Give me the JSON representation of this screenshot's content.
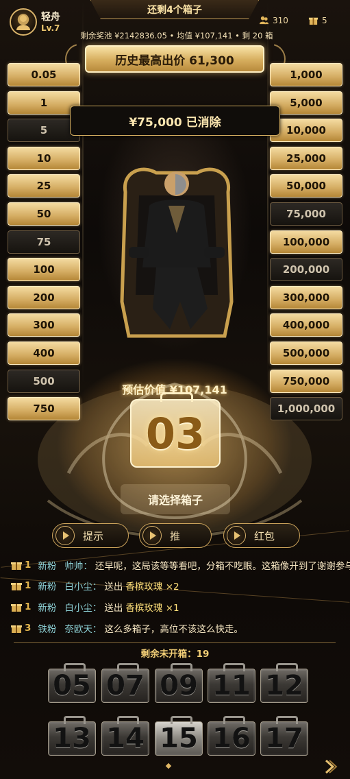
{
  "header": {
    "boxes_left_title": "还剩4个箱子",
    "user_name": "轻舟",
    "user_level": "Lv.7",
    "viewers_count": "310",
    "gifts_count": "5",
    "pool_info": "剩余奖池 ¥2142836.05 • 均值 ¥107,141 • 剩 20 箱",
    "record_text": "历史最高出价  61,300"
  },
  "values_left": [
    {
      "label": "0.05",
      "state": "on"
    },
    {
      "label": "1",
      "state": "on"
    },
    {
      "label": "5",
      "state": "off"
    },
    {
      "label": "10",
      "state": "on"
    },
    {
      "label": "25",
      "state": "on"
    },
    {
      "label": "50",
      "state": "on"
    },
    {
      "label": "75",
      "state": "off"
    },
    {
      "label": "100",
      "state": "on"
    },
    {
      "label": "200",
      "state": "on"
    },
    {
      "label": "300",
      "state": "on"
    },
    {
      "label": "400",
      "state": "on"
    },
    {
      "label": "500",
      "state": "off"
    },
    {
      "label": "750",
      "state": "on"
    }
  ],
  "values_right": [
    {
      "label": "1,000",
      "state": "on"
    },
    {
      "label": "5,000",
      "state": "on"
    },
    {
      "label": "10,000",
      "state": "on"
    },
    {
      "label": "25,000",
      "state": "on"
    },
    {
      "label": "50,000",
      "state": "on"
    },
    {
      "label": "75,000",
      "state": "off"
    },
    {
      "label": "100,000",
      "state": "on"
    },
    {
      "label": "200,000",
      "state": "off"
    },
    {
      "label": "300,000",
      "state": "on"
    },
    {
      "label": "400,000",
      "state": "on"
    },
    {
      "label": "500,000",
      "state": "on"
    },
    {
      "label": "750,000",
      "state": "on"
    },
    {
      "label": "1,000,000",
      "state": "off"
    }
  ],
  "eliminated_banner": "¥75,000 已消除",
  "center": {
    "estimate_text": "预估价值 ¥107,141",
    "selected_case": "03",
    "choose_prompt": "请选择箱子"
  },
  "actions": {
    "hint_label": "提示",
    "push_label": "推",
    "redpacket_label": "红包"
  },
  "chat": [
    {
      "count": "1",
      "tier": "新粉",
      "nick": "帅帅：",
      "message": "还早呢，这局该等等看吧，分箱不吃眼。这箱像开到了谢谢参与，但开局可以。",
      "gift": ""
    },
    {
      "count": "1",
      "tier": "新粉",
      "nick": "白小尘：",
      "message": "送出 ",
      "gift": "香槟玫瑰 ×2"
    },
    {
      "count": "1",
      "tier": "新粉",
      "nick": "白小尘：",
      "message": "送出 ",
      "gift": "香槟玫瑰 ×1"
    },
    {
      "count": "3",
      "tier": "铁粉",
      "nick": "奈欧天：",
      "message": "这么多箱子，高位不该这么快走。",
      "gift": ""
    }
  ],
  "remaining_text": "剩余未开箱：19",
  "cases_row1": [
    "05",
    "07",
    "09",
    "11",
    "12"
  ],
  "cases_row2": [
    "13",
    "14",
    "15",
    "16",
    "17"
  ],
  "colors": {
    "gold": "#d4ac62",
    "dark": "#16130f",
    "accent_text": "#8fd3d8"
  }
}
